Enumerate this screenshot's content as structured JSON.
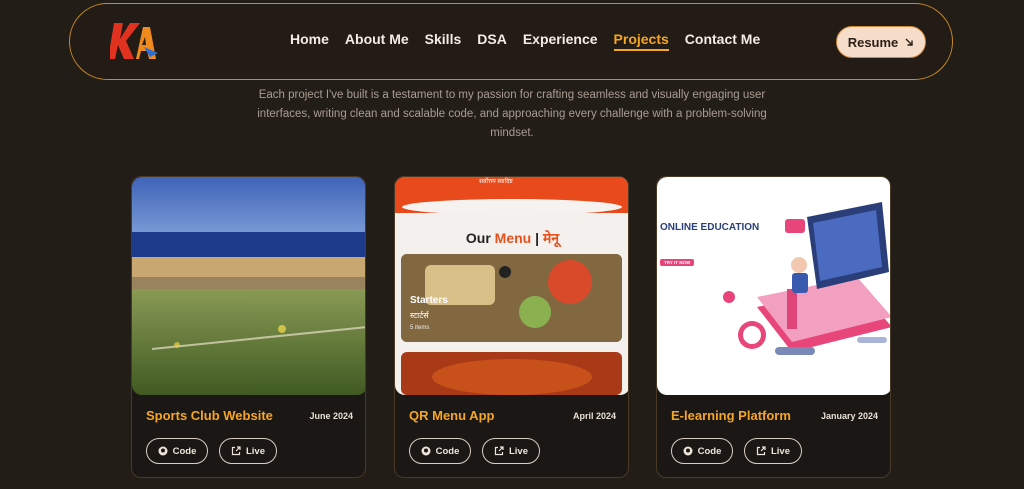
{
  "nav": {
    "links": [
      "Home",
      "About Me",
      "Skills",
      "DSA",
      "Experience",
      "Projects",
      "Contact Me"
    ],
    "active": "Projects",
    "resume_label": "Resume"
  },
  "logo": {
    "text": "KA"
  },
  "intro": {
    "text": "Each project I've built is a testament to my passion for crafting seamless and visually engaging user interfaces, writing clean and scalable code, and approaching every challenge with a problem-solving mindset."
  },
  "projects": [
    {
      "title": "Sports Club Website",
      "date": "June 2024",
      "code_label": "Code",
      "live_label": "Live",
      "image": "stadium-field-photo"
    },
    {
      "title": "QR Menu App",
      "date": "April 2024",
      "code_label": "Code",
      "live_label": "Live",
      "image": "menu-app-screenshot"
    },
    {
      "title": "E-learning Platform",
      "date": "January 2024",
      "code_label": "Code",
      "live_label": "Live",
      "image": "online-education-illustration"
    }
  ],
  "menu_preview": {
    "heading_our": "Our",
    "heading_menu": "Menu",
    "heading_sep": " | ",
    "heading_native": "मेनू",
    "top_text": "सर्वोत्तम स्वादिष्ट",
    "category": "Starters",
    "category_native": "स्टार्टर्स",
    "items": "5 items"
  },
  "elearn_preview": {
    "title": "ONLINE EDUCATION",
    "cta": "TRY IT NOW"
  },
  "colors": {
    "accent": "#f5a623",
    "background": "#231d18",
    "nav_border": "#c98a25",
    "resume_bg": "#f6ddc9"
  }
}
